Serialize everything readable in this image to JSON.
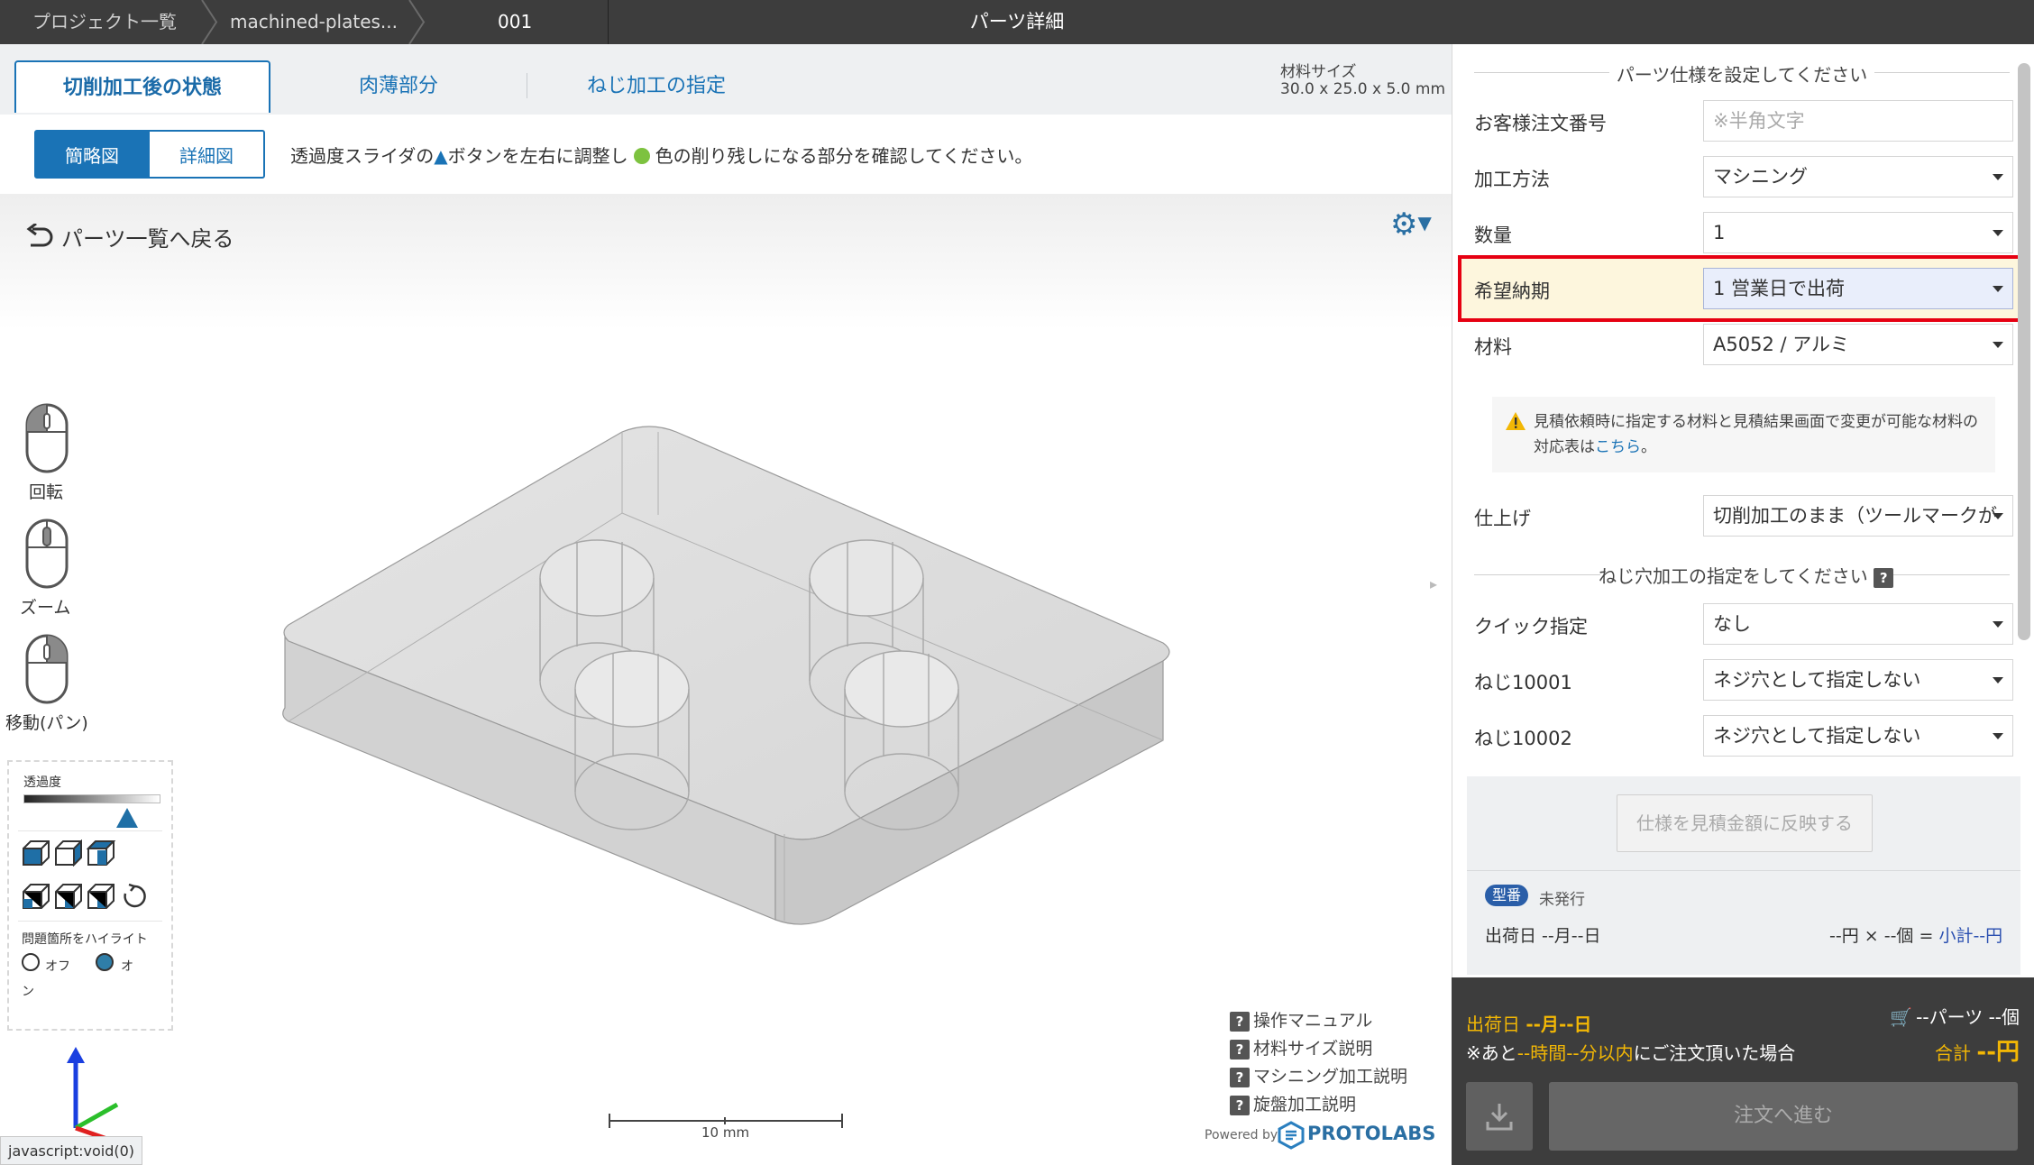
{
  "breadcrumbs": {
    "project_list": "プロジェクト一覧",
    "file": "machined-plates...",
    "part_no": "001"
  },
  "page_title": "パーツ詳細",
  "tabs": [
    "切削加工後の状態",
    "肉薄部分",
    "ねじ加工の指定"
  ],
  "material_size": {
    "label": "材料サイズ",
    "value": "30.0 x 25.0 x 5.0 mm"
  },
  "view_toggle": {
    "simple": "簡略図",
    "detail": "詳細図"
  },
  "instruction": {
    "part1": "透過度スライダの",
    "part2": "ボタンを左右に調整し",
    "part3": "色の削り残しになる部分を確認してください。"
  },
  "back_link": "パーツ一覧へ戻る",
  "mouse_controls": {
    "rotate": "回転",
    "zoom": "ズーム",
    "pan": "移動(パン)"
  },
  "transparency_label": "透過度",
  "transparency_level": 0.76,
  "highlight": {
    "title": "問題箇所をハイライト",
    "off": "オフ",
    "on_line1": "オ",
    "on_line2": "ン"
  },
  "scale_bar": "10 mm",
  "help_links": [
    "操作マニュアル",
    "材料サイズ説明",
    "マシニング加工説明",
    "旋盤加工説明"
  ],
  "powered_by": "Powered by",
  "brand": "PROTOLABS",
  "status_text": "javascript:void(0)",
  "spec": {
    "header": "パーツ仕様を設定してください",
    "customer_order_label": "お客様注文番号",
    "customer_order_placeholder": "※半角文字",
    "process_label": "加工方法",
    "process_value": "マシニング",
    "qty_label": "数量",
    "qty_value": "1",
    "delivery_label": "希望納期",
    "delivery_value": "1 営業日で出荷",
    "material_label": "材料",
    "material_value": "A5052 / アルミ",
    "note_text": "見積依頼時に指定する材料と見積結果画面で変更が可能な材料の対応表は",
    "note_link": "こちら",
    "note_end": "。",
    "finish_label": "仕上げ",
    "finish_value": "切削加工のまま（ツールマークが"
  },
  "thread": {
    "header": "ねじ穴加工の指定をしてください",
    "quick_label": "クイック指定",
    "quick_value": "なし",
    "thread1_label": "ねじ10001",
    "thread1_value": "ネジ穴として指定しない",
    "thread2_label": "ねじ10002",
    "thread2_value": "ネジ穴として指定しない"
  },
  "summary": {
    "reflect_button": "仕様を見積金額に反映する",
    "mold_badge": "型番",
    "mold_status": "未発行",
    "ship_date": "出荷日 --月--日",
    "calc_part1": "--円 × --個 = ",
    "calc_subtotal": "小計--円"
  },
  "bottom": {
    "ship_prefix": "出荷日 ",
    "ship_value": "--月--日",
    "deadline_prefix": "※あと",
    "deadline_value": "--時間--分以内",
    "deadline_suffix": "にご注文頂いた場合",
    "parts_count": "--パーツ --個",
    "total_label": "合計 ",
    "total_value": "--円",
    "order_button": "注文へ進む"
  },
  "colors": {
    "accent": "#1a73b6",
    "highlight_border": "#e60012",
    "gold": "#f2b705",
    "topbar": "#3d3d3d"
  }
}
